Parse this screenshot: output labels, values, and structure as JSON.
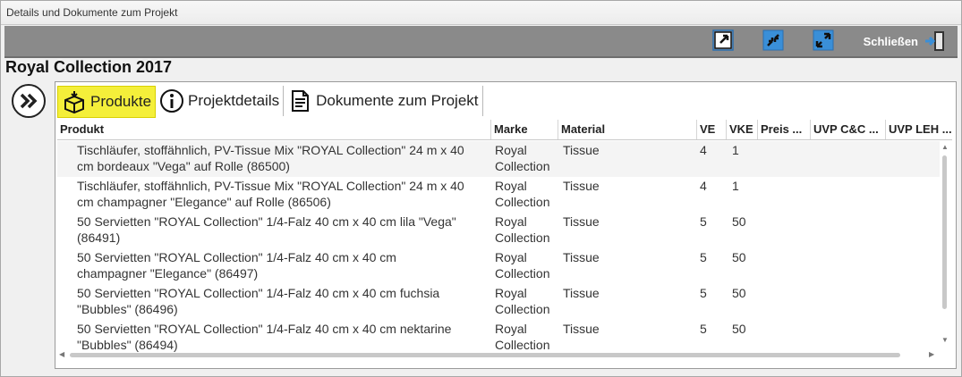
{
  "window": {
    "title": "Details und Dokumente zum Projekt"
  },
  "toolbar": {
    "close_label": "Schließen"
  },
  "project": {
    "title": "Royal Collection 2017"
  },
  "tabs": [
    {
      "label": "Produkte",
      "active": true,
      "icon": "box-icon"
    },
    {
      "label": "Projektdetails",
      "active": false,
      "icon": "info-icon"
    },
    {
      "label": "Dokumente zum Projekt",
      "active": false,
      "icon": "document-icon"
    }
  ],
  "table": {
    "columns": [
      "Produkt",
      "Marke",
      "Material",
      "VE",
      "VKE",
      "Preis ...",
      "UVP C&C ...",
      "UVP LEH ..."
    ],
    "rows": [
      {
        "produkt1": "Tischläufer, stoffähnlich, PV-Tissue Mix \"ROYAL Collection\" 24 m x 40",
        "produkt2": "cm bordeaux \"Vega\" auf Rolle  (86500)",
        "marke1": "Royal",
        "marke2": "Collection",
        "material": "Tissue",
        "ve": "4",
        "vke": "1"
      },
      {
        "produkt1": "Tischläufer, stoffähnlich, PV-Tissue Mix \"ROYAL Collection\" 24 m x 40",
        "produkt2": "cm champagner \"Elegance\" auf Rolle  (86506)",
        "marke1": "Royal",
        "marke2": "Collection",
        "material": "Tissue",
        "ve": "4",
        "vke": "1"
      },
      {
        "produkt1": "50 Servietten \"ROYAL Collection\" 1/4-Falz 40 cm x 40 cm lila \"Vega\"",
        "produkt2": "(86491)",
        "marke1": "Royal",
        "marke2": "Collection",
        "material": "Tissue",
        "ve": "5",
        "vke": "50"
      },
      {
        "produkt1": "50 Servietten \"ROYAL Collection\" 1/4-Falz 40 cm x 40 cm",
        "produkt2": "champagner \"Elegance\"  (86497)",
        "marke1": "Royal",
        "marke2": "Collection",
        "material": "Tissue",
        "ve": "5",
        "vke": "50"
      },
      {
        "produkt1": "50 Servietten \"ROYAL Collection\" 1/4-Falz 40 cm x 40 cm fuchsia",
        "produkt2": "\"Bubbles\"  (86496)",
        "marke1": "Royal",
        "marke2": "Collection",
        "material": "Tissue",
        "ve": "5",
        "vke": "50"
      },
      {
        "produkt1": "50 Servietten \"ROYAL Collection\" 1/4-Falz 40 cm x 40 cm nektarine",
        "produkt2": "\"Bubbles\"  (86494)",
        "marke1": "Royal",
        "marke2": "Collection",
        "material": "Tissue",
        "ve": "5",
        "vke": "50"
      }
    ]
  },
  "colors": {
    "toolbar_bg": "#8a8a8a",
    "active_tab": "#f4ef3a",
    "icon_blue": "#3a8fd8"
  }
}
